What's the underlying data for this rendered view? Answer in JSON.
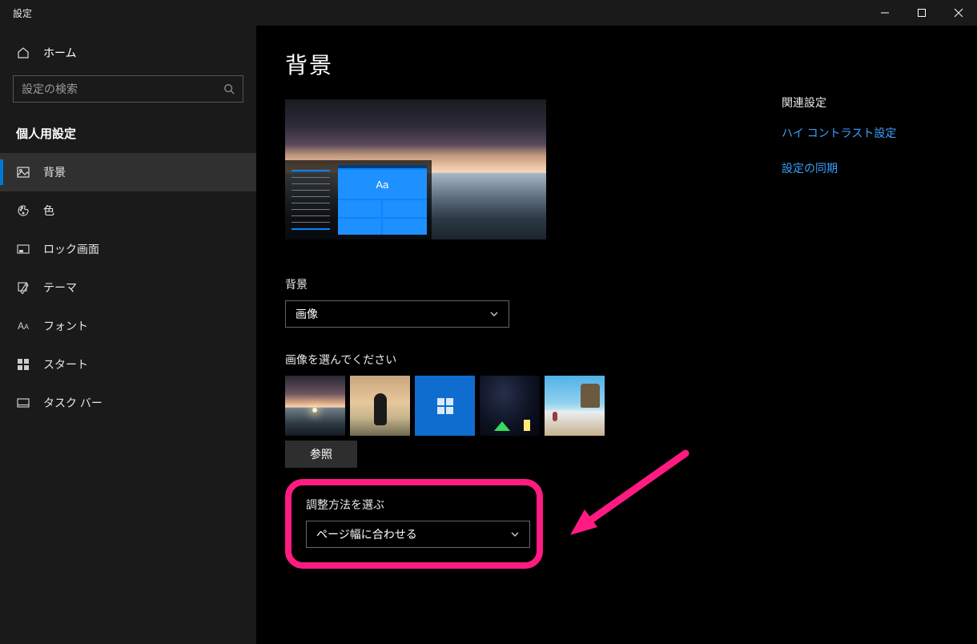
{
  "window": {
    "title": "設定"
  },
  "sidebar": {
    "home": "ホーム",
    "search_placeholder": "設定の検索",
    "section": "個人用設定",
    "items": [
      {
        "label": "背景",
        "icon": "picture-icon",
        "selected": true
      },
      {
        "label": "色",
        "icon": "palette-icon"
      },
      {
        "label": "ロック画面",
        "icon": "lock-screen-icon"
      },
      {
        "label": "テーマ",
        "icon": "theme-icon"
      },
      {
        "label": "フォント",
        "icon": "font-icon"
      },
      {
        "label": "スタート",
        "icon": "start-icon"
      },
      {
        "label": "タスク バー",
        "icon": "taskbar-icon"
      }
    ]
  },
  "main": {
    "title": "背景",
    "preview_tile_text": "Aa",
    "background_label": "背景",
    "background_value": "画像",
    "choose_image_label": "画像を選んでください",
    "browse_label": "参照",
    "fit_label": "調整方法を選ぶ",
    "fit_value": "ページ幅に合わせる"
  },
  "related": {
    "title": "関連設定",
    "links": [
      "ハイ コントラスト設定",
      "設定の同期"
    ]
  }
}
